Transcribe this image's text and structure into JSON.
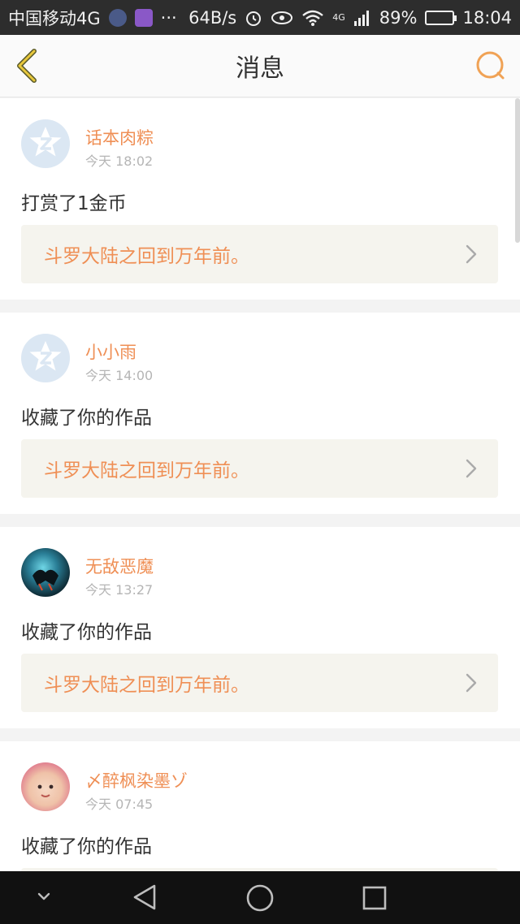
{
  "status_bar": {
    "carrier": "中国移动4G",
    "dots": "···",
    "speed": "64B/s",
    "network": "4G",
    "battery_percent": "89%",
    "battery_level": 0.89,
    "time": "18:04"
  },
  "header": {
    "title": "消息",
    "back_icon": "chevron-left-icon",
    "search_icon": "search-icon",
    "accent_color": "#f0a255"
  },
  "messages": [
    {
      "username": "话本肉粽",
      "time": "今天 18:02",
      "action": "打赏了1金币",
      "work_title": "斗罗大陆之回到万年前。",
      "avatar": "default"
    },
    {
      "username": "小小雨",
      "time": "今天 14:00",
      "action": "收藏了你的作品",
      "work_title": "斗罗大陆之回到万年前。",
      "avatar": "default"
    },
    {
      "username": "无敌恶魔",
      "time": "今天 13:27",
      "action": "收藏了你的作品",
      "work_title": "斗罗大陆之回到万年前。",
      "avatar": "dark"
    },
    {
      "username": "〆醉枫染墨ゾ",
      "time": "今天 07:45",
      "action": "收藏了你的作品",
      "work_title": "",
      "avatar": "baby"
    }
  ],
  "colors": {
    "username": "#ef8f55",
    "work_title": "#ef8f55",
    "card_link_bg": "#f5f4ee",
    "status_bar_bg": "#2d2d2d",
    "nav_bar_bg": "#111111"
  },
  "system_nav": {
    "items": [
      "chevron-down-icon",
      "back-triangle-icon",
      "home-circle-icon",
      "recents-square-icon"
    ]
  }
}
